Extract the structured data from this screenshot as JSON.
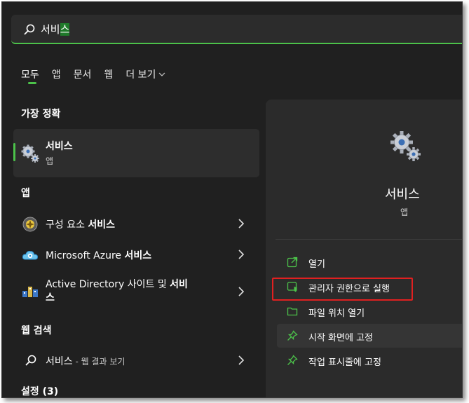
{
  "search": {
    "query_prefix": "서비",
    "query_selected": "스"
  },
  "tabs": [
    {
      "label": "모두"
    },
    {
      "label": "앱"
    },
    {
      "label": "문서"
    },
    {
      "label": "웹"
    },
    {
      "label": "더 보기"
    }
  ],
  "best_match": {
    "header": "가장 정확",
    "title": "서비스",
    "subtitle": "앱"
  },
  "apps": {
    "header": "앱",
    "items": [
      {
        "prefix": "구성 요소 ",
        "bold": "서비스"
      },
      {
        "prefix": "Microsoft Azure ",
        "bold": "서비스"
      },
      {
        "prefix": "Active Directory 사이트 및 ",
        "bold": "서비",
        "line2": "스"
      }
    ]
  },
  "web": {
    "header": "웹 검색",
    "item": {
      "query": "서비스",
      "suffix": " - 웹 결과 보기"
    }
  },
  "settings": {
    "header": "설정 (3)"
  },
  "detail": {
    "name": "서비스",
    "type": "앱",
    "actions": [
      {
        "label": "열기",
        "icon": "open-icon"
      },
      {
        "label": "관리자 권한으로 실행",
        "icon": "shield-icon"
      },
      {
        "label": "파일 위치 열기",
        "icon": "folder-icon"
      },
      {
        "label": "시작 화면에 고정",
        "icon": "pin-icon"
      },
      {
        "label": "작업 표시줄에 고정",
        "icon": "pin-icon"
      }
    ]
  },
  "colors": {
    "accent": "#4cc24a",
    "highlight": "#e02020",
    "background": "#202020"
  }
}
